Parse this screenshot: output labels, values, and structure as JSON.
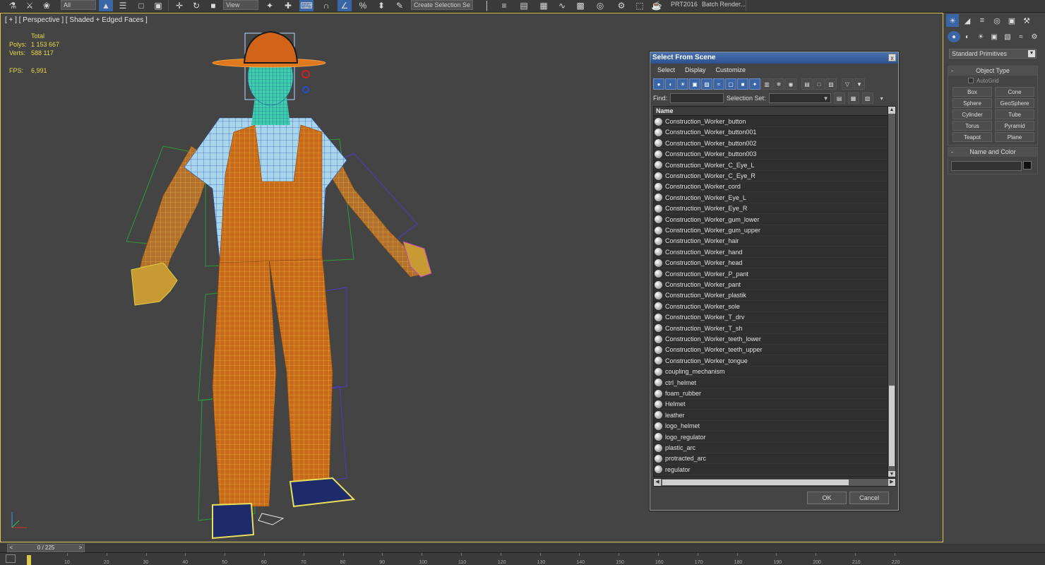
{
  "toolbar": {
    "filter_dropdown": "All",
    "view_dropdown": "View",
    "create_selection": "Create Selection Se",
    "prt_label": "PRT2016",
    "batch_render": "Batch Render..."
  },
  "viewport": {
    "label": "[ + ] [ Perspective ] [ Shaded + Edged Faces ]",
    "stats": {
      "total_label": "Total",
      "polys_label": "Polys:",
      "polys_value": "1 153 667",
      "verts_label": "Verts:",
      "verts_value": "588 117",
      "fps_label": "FPS:",
      "fps_value": "6,991"
    }
  },
  "dialog": {
    "title": "Select From Scene",
    "close": "x",
    "menu": [
      "Select",
      "Display",
      "Customize"
    ],
    "find_label": "Find:",
    "find_value": "",
    "selection_set_label": "Selection Set:",
    "selection_set_value": "",
    "column_header": "Name",
    "items": [
      "Construction_Worker_button",
      "Construction_Worker_button001",
      "Construction_Worker_button002",
      "Construction_Worker_button003",
      "Construction_Worker_C_Eye_L",
      "Construction_Worker_C_Eye_R",
      "Construction_Worker_cord",
      "Construction_Worker_Eye_L",
      "Construction_Worker_Eye_R",
      "Construction_Worker_gum_lower",
      "Construction_Worker_gum_upper",
      "Construction_Worker_hair",
      "Construction_Worker_hand",
      "Construction_Worker_head",
      "Construction_Worker_P_pant",
      "Construction_Worker_pant",
      "Construction_Worker_plastik",
      "Construction_Worker_sole",
      "Construction_Worker_T_drv",
      "Construction_Worker_T_sh",
      "Construction_Worker_teeth_lower",
      "Construction_Worker_teeth_upper",
      "Construction_Worker_tongue",
      "coupling_mechanism",
      "ctrl_helmet",
      "foam_rubber",
      "Helmet",
      "leather",
      "logo_helmet",
      "logo_regulator",
      "plastic_arc",
      "protracted_arc",
      "regulator"
    ],
    "ok": "OK",
    "cancel": "Cancel"
  },
  "command_panel": {
    "primitive_dropdown": "Standard Primitives",
    "object_type_title": "Object Type",
    "autogrid_label": "AutoGrid",
    "primitives": [
      "Box",
      "Cone",
      "Sphere",
      "GeoSphere",
      "Cylinder",
      "Tube",
      "Torus",
      "Pyramid",
      "Teapot",
      "Plane"
    ],
    "name_color_title": "Name and Color",
    "name_value": "",
    "object_color": "#111111"
  },
  "timeline": {
    "frame_display": "0 / 225",
    "ticks": [
      "10",
      "20",
      "30",
      "40",
      "50",
      "60",
      "70",
      "80",
      "90",
      "100",
      "110",
      "120",
      "130",
      "140",
      "150",
      "160",
      "170",
      "180",
      "190",
      "200",
      "210",
      "220"
    ]
  },
  "colors": {
    "accent": "#3a66a8",
    "stats_text": "#e6d84a",
    "viewport_border": "#d9c850"
  }
}
